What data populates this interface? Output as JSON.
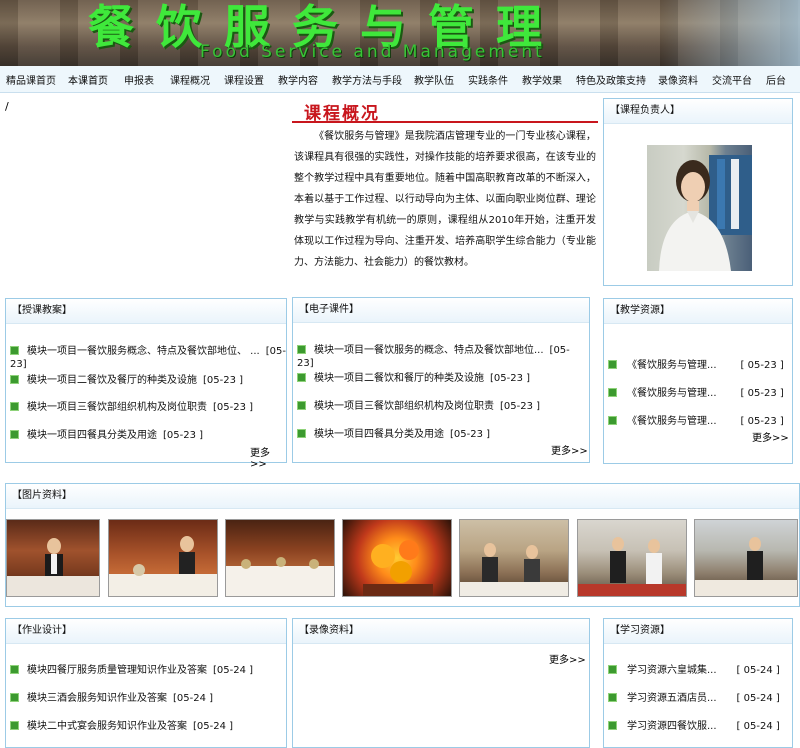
{
  "banner": {
    "title": "餐饮服务与管理",
    "subtitle": "Food Service and Management"
  },
  "nav": [
    "精品课首页",
    "本课首页",
    "申报表",
    "课程概况",
    "课程设置",
    "教学内容",
    "教学方法与手段",
    "教学队伍",
    "实践条件",
    "教学效果",
    "特色及政策支持",
    "录像资料",
    "交流平台",
    "后台"
  ],
  "breadcrumb": "/",
  "overview": {
    "title": "课程概况",
    "text": "《餐饮服务与管理》是我院酒店管理专业的一门专业核心课程，该课程具有很强的实践性，对操作技能的培养要求很高，在该专业的整个教学过程中具有重要地位。随着中国高职教育改革的不断深入，本着以基于工作过程、以行动导向为主体、以面向职业岗位群、理论教学与实践教学有机统一的原则，课程组从2010年开始，注重开发体现以工作过程为导向、注重开发、培养高职学生综合能力（专业能力、方法能力、社会能力）的餐饮教材。"
  },
  "leader": {
    "title": "【课程负责人】"
  },
  "teaching_plan": {
    "title": "【授课教案】",
    "items": [
      {
        "text": "模块一项目一餐饮服务概念、特点及餐饮部地位、 ...",
        "date": "[05-23]"
      },
      {
        "text": "模块一项目二餐饮及餐厅的种类及设施",
        "date": "[05-23 ]"
      },
      {
        "text": "模块一项目三餐饮部组织机构及岗位职责",
        "date": "[05-23 ]"
      },
      {
        "text": "模块一项目四餐具分类及用途",
        "date": "[05-23 ]"
      }
    ],
    "more": "更多>>"
  },
  "courseware": {
    "title": "【电子课件】",
    "items": [
      {
        "text": "模块一项目一餐饮服务的概念、特点及餐饮部地位...",
        "date": "[05-23]"
      },
      {
        "text": "模块一项目二餐饮和餐厅的种类及设施",
        "date": "[05-23 ]"
      },
      {
        "text": "模块一项目三餐饮部组织机构及岗位职责",
        "date": "[05-23 ]"
      },
      {
        "text": "模块一项目四餐具分类及用途",
        "date": "[05-23 ]"
      }
    ],
    "more": "更多>>"
  },
  "resources": {
    "title": "【教学资源】",
    "items": [
      {
        "text": "《餐饮服务与管理...",
        "date": "[ 05-23 ]"
      },
      {
        "text": "《餐饮服务与管理...",
        "date": "[ 05-23 ]"
      },
      {
        "text": "《餐饮服务与管理...",
        "date": "[ 05-23 ]"
      }
    ],
    "more": "更多>>"
  },
  "photos": {
    "title": "【图片资料】"
  },
  "homework": {
    "title": "【作业设计】",
    "items": [
      {
        "text": "模块四餐厅服务质量管理知识作业及答案",
        "date": "[05-24 ]"
      },
      {
        "text": "模块三酒会服务知识作业及答案",
        "date": "[05-24 ]"
      },
      {
        "text": "模块二中式宴会服务知识作业及答案",
        "date": "[05-24 ]"
      }
    ]
  },
  "video": {
    "title": "【录像资料】",
    "more": "更多>>"
  },
  "learning": {
    "title": "【学习资源】",
    "items": [
      {
        "text": "学习资源六皇城集...",
        "date": "[ 05-24 ]"
      },
      {
        "text": "学习资源五酒店员...",
        "date": "[ 05-24 ]"
      },
      {
        "text": "学习资源四餐饮服...",
        "date": "[ 05-24 ]"
      }
    ]
  }
}
